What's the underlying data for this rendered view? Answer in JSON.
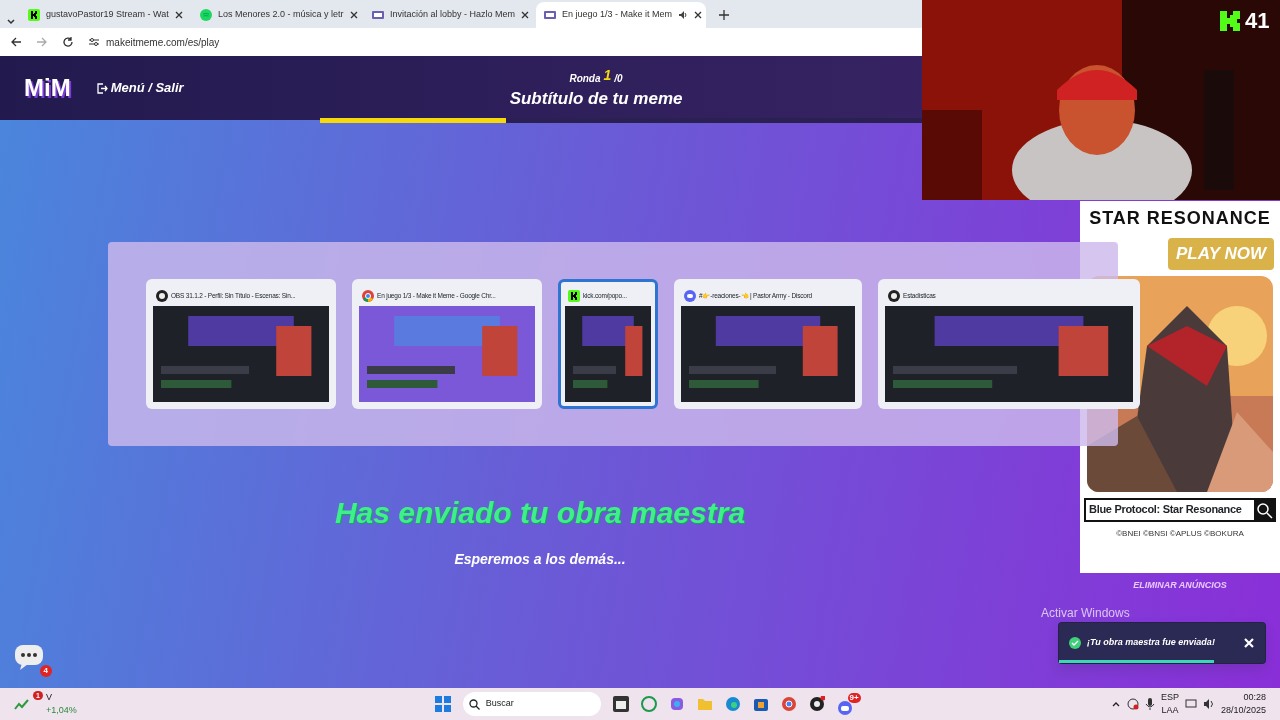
{
  "browser": {
    "tabs": [
      {
        "title": "gustavoPastor19 Stream - Wat",
        "selected": false,
        "audio": false
      },
      {
        "title": "Los Menores 2.0 - música y letr",
        "selected": false,
        "audio": false
      },
      {
        "title": "Invitación al lobby - Hazlo Mem",
        "selected": false,
        "audio": false
      },
      {
        "title": "En juego 1/3 - Make it Mem",
        "selected": true,
        "audio": true
      }
    ],
    "address": "makeitmeme.com/es/play"
  },
  "header": {
    "logo": "MiM",
    "menu": "Menú / Salir",
    "round_label": "Ronda",
    "round_current": "1",
    "round_total": "/0",
    "title": "Subtítulo de tu meme",
    "level": 0.29
  },
  "message": {
    "title": "Has enviado tu obra maestra",
    "subtitle": "Esperemos a los demás..."
  },
  "switcher": [
    {
      "title": "OBS 31.1.2 - Perfil: Sin Título - Escenas: Sin...",
      "selected": false
    },
    {
      "title": "En juego 1/3 - Make it Meme - Google Chr...",
      "selected": false
    },
    {
      "title": "kick.com/popo...",
      "selected": true
    },
    {
      "title": "#👉-reaciones-👈 | Pastor Army - Discord",
      "selected": false
    },
    {
      "title": "Estadísticas",
      "selected": false
    }
  ],
  "ad": {
    "logo": "STAR RESONANCE",
    "cta": "PLAY NOW",
    "search_text": "Blue Protocol: Star Resonance",
    "copyright": "©BNEI ©BNSI ©APLUS ©BOKURA",
    "remove": "ELIMINAR ANÚNCIOS"
  },
  "webcam": {
    "channel_count": "41"
  },
  "chat_badge": "4",
  "toast": {
    "text": "¡Tu obra maestra fue enviada!",
    "level": 0.75
  },
  "os_notice": "Activar Windows",
  "taskbar": {
    "stock_badge": "1",
    "stock_name": "V",
    "stock_change": "+1,04%",
    "search": "Buscar",
    "discord_badge": "9+",
    "lang": "ESP",
    "layout": "LAA",
    "time": "00:28",
    "date": "28/10/2025"
  }
}
